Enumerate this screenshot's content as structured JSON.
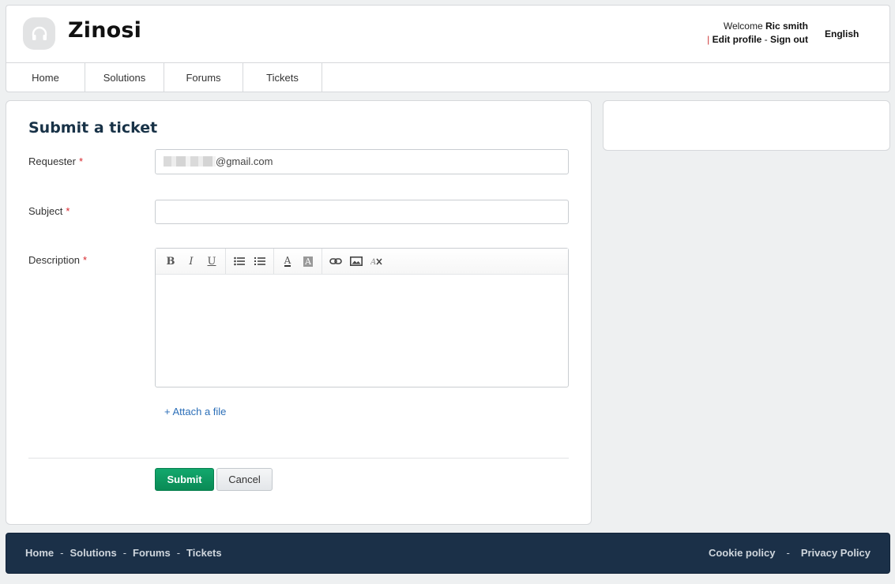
{
  "header": {
    "brand": "Zinosi",
    "welcome_prefix": "Welcome",
    "user_name": "Ric smith",
    "edit_profile": "Edit profile",
    "sign_out": "Sign out",
    "link_separator": "-",
    "language": "English"
  },
  "nav": {
    "items": [
      {
        "label": "Home"
      },
      {
        "label": "Solutions"
      },
      {
        "label": "Forums"
      },
      {
        "label": "Tickets"
      }
    ]
  },
  "form": {
    "title": "Submit a ticket",
    "requester_label": "Requester",
    "requester_value_visible": "@gmail.com",
    "subject_label": "Subject",
    "subject_value": "",
    "description_label": "Description",
    "required_marker": "*",
    "toolbar": {
      "bold": "B",
      "italic": "I",
      "underline": "U",
      "font_color": "A",
      "bg_color": "A"
    },
    "attach_label": "+ Attach a file",
    "submit_label": "Submit",
    "cancel_label": "Cancel"
  },
  "footer": {
    "links": [
      "Home",
      "Solutions",
      "Forums",
      "Tickets"
    ],
    "separator": "-",
    "cookie_policy": "Cookie policy",
    "privacy_policy": "Privacy Policy"
  },
  "colors": {
    "accent_green": "#0a8a55",
    "footer_bg": "#1b3048",
    "link_blue": "#2c6fb8",
    "required_red": "#d7272d"
  }
}
